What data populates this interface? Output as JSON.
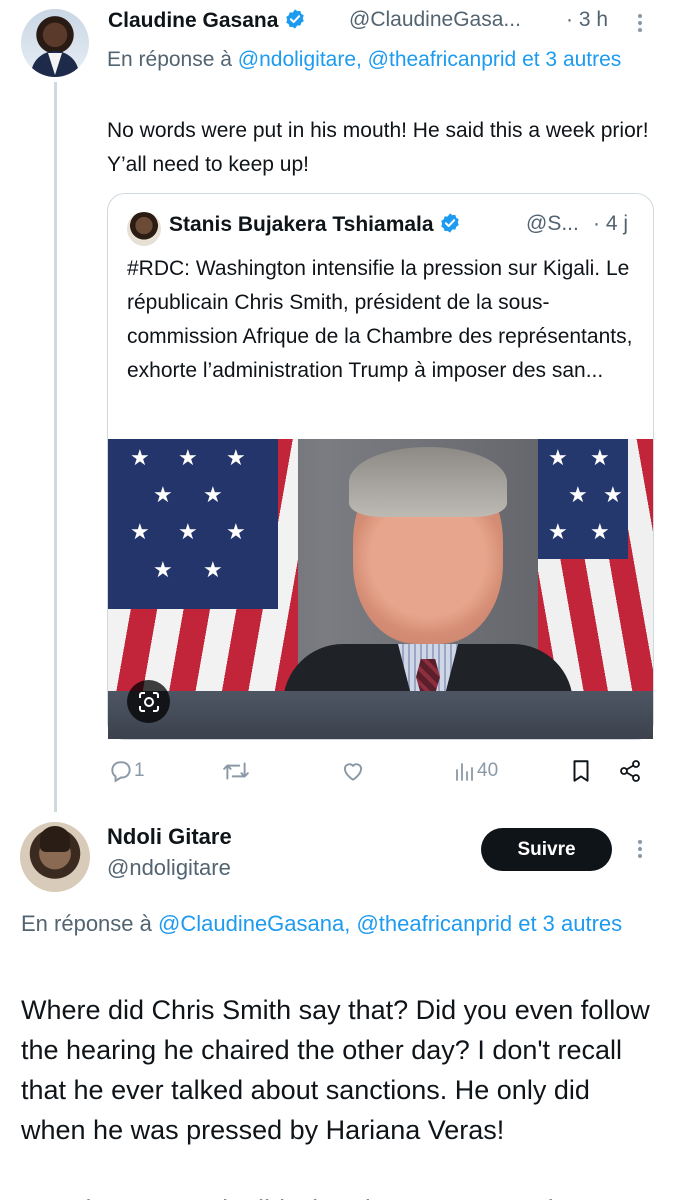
{
  "tweet1": {
    "author_name": "Claudine Gasana",
    "handle": "@ClaudineGasa...",
    "time": "· 3 h",
    "reply_prefix": "En réponse à",
    "reply_to": "@ndoligitare, @theafricanprid",
    "reply_suffix": "et 3 autres",
    "text": "No words were put in his mouth! He said this a week prior! Y’all need to keep up!"
  },
  "quote": {
    "author_name": "Stanis Bujakera Tshiamala",
    "handle": "@S...",
    "time": "· 4 j",
    "text": "#RDC: Washington intensifie la pression sur Kigali. Le républicain Chris Smith, président de la sous-commission Afrique de la Chambre des représentants, exhorte l’administration Trump à imposer des san..."
  },
  "actions": {
    "reply_count": "1",
    "views_count": "40"
  },
  "tweet2": {
    "author_name": "Ndoli Gitare",
    "handle": "@ndoligitare",
    "follow_label": "Suivre",
    "reply_prefix": "En réponse à",
    "reply_to": "@ClaudineGasana, @theafricanprid",
    "reply_suffix": "et 3 autres",
    "text": "Where did Chris Smith say that? Did you even follow the hearing he chaired the other day? I don't recall that he ever talked about sanctions. He only did when he was pressed by Hariana Veras!",
    "text_cut": "sanctions. He only did when he was pressed"
  },
  "colors": {
    "link": "#1d9bf0",
    "verified": "#1d9bf0",
    "secondary_text": "#536471",
    "follow_button": "#0f1419"
  },
  "icons": [
    "verified-badge-icon",
    "more-icon",
    "reply-icon",
    "retweet-icon",
    "like-icon",
    "views-icon",
    "bookmark-icon",
    "share-icon",
    "lens-icon"
  ]
}
